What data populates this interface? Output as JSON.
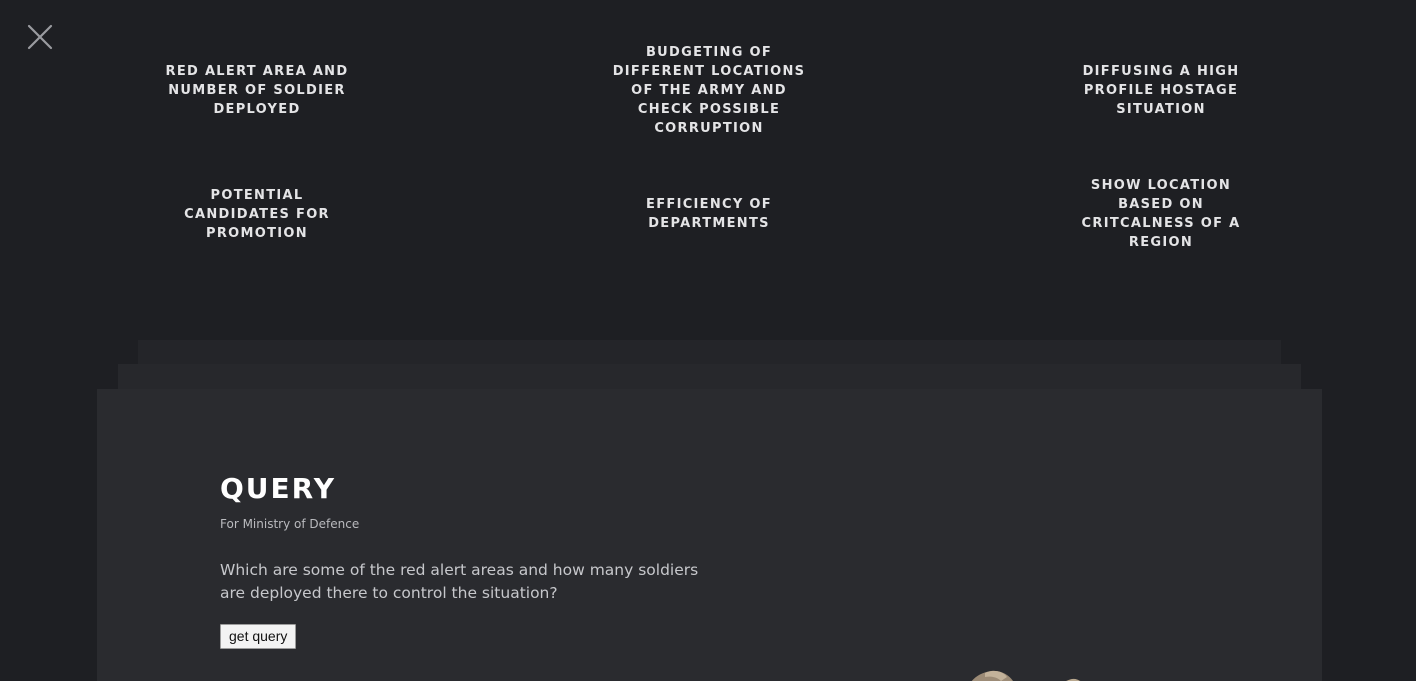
{
  "close": {
    "icon": "close-icon"
  },
  "menu": {
    "items": [
      {
        "label": "RED ALERT AREA AND NUMBER OF SOLDIER DEPLOYED"
      },
      {
        "label": "BUDGETING OF DIFFERENT LOCATIONS OF THE ARMY AND CHECK POSSIBLE CORRUPTION"
      },
      {
        "label": "DIFFUSING A HIGH PROFILE HOSTAGE SITUATION"
      },
      {
        "label": "POTENTIAL CANDIDATES FOR PROMOTION"
      },
      {
        "label": "EFFICIENCY OF DEPARTMENTS"
      },
      {
        "label": "SHOW LOCATION BASED ON CRITCALNESS OF A REGION"
      }
    ]
  },
  "query": {
    "title": "QUERY",
    "subtitle": "For Ministry of Defence",
    "question": "Which are some of the red alert areas and how many soldiers are deployed there to control the situation?",
    "button_label": "get query"
  },
  "colors": {
    "background": "#1e1f23",
    "panel": "#2a2b2f",
    "menu_text": "#e4e4e6",
    "title": "#ffffff"
  }
}
